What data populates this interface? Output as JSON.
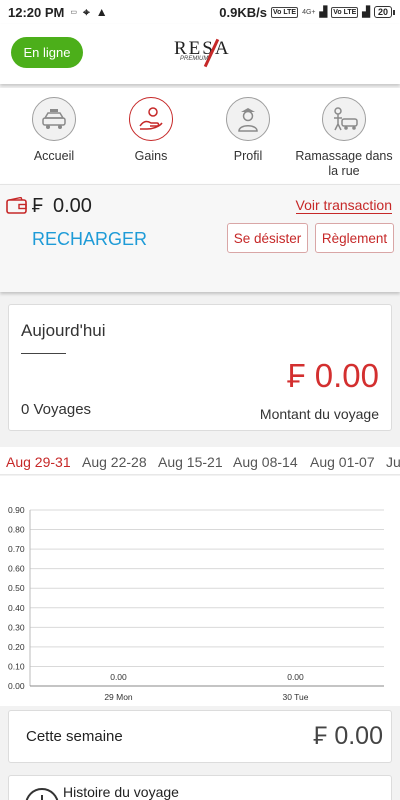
{
  "status_bar": {
    "time": "12:20 PM",
    "network_speed": "0.9KB/s",
    "badge_vo1": "Vo LTE",
    "network_label": "4G+",
    "badge_vo2": "Vo LTE",
    "battery": "20"
  },
  "header": {
    "status_button": "En ligne",
    "logo_word": "RESA",
    "logo_sub": "PREMIUM",
    "brand_color": "#c62828"
  },
  "nav": {
    "items": [
      {
        "label": "Accueil",
        "icon": "taxi-icon"
      },
      {
        "label": "Gains",
        "icon": "hand-coin-icon",
        "active": true
      },
      {
        "label": "Profil",
        "icon": "driver-icon"
      },
      {
        "label": "Ramassage dans la rue",
        "icon": "street-pickup-icon"
      }
    ]
  },
  "wallet": {
    "currency": "₣",
    "balance": "0.00",
    "view_transactions": "Voir transaction",
    "recharge": "RECHARGER",
    "withdraw": "Se désister",
    "settlement": "Règlement"
  },
  "today": {
    "title": "Aujourd'hui",
    "amount": "₣ 0.00",
    "trips": "0 Voyages",
    "caption": "Montant du voyage"
  },
  "weeks": {
    "tabs": [
      "Aug 29-31",
      "Aug 22-28",
      "Aug 15-21",
      "Aug 08-14",
      "Aug 01-07",
      "Ju"
    ],
    "active_index": 0
  },
  "chart_data": {
    "type": "bar",
    "categories": [
      "29 Mon",
      "30 Tue"
    ],
    "values": [
      0.0,
      0.0
    ],
    "data_labels": [
      "0.00",
      "0.00"
    ],
    "ylim": [
      0,
      0.9
    ],
    "yticks": [
      "0.00",
      "0.10",
      "0.20",
      "0.30",
      "0.40",
      "0.50",
      "0.60",
      "0.70",
      "0.80",
      "0.90"
    ],
    "grid": true
  },
  "week_total": {
    "title": "Cette semaine",
    "amount": "₣ 0.00"
  },
  "history": {
    "label": "Histoire du voyage"
  },
  "colors": {
    "accent_red": "#c62828",
    "online_green": "#4caf1a",
    "link_blue": "#1e9bd7"
  }
}
